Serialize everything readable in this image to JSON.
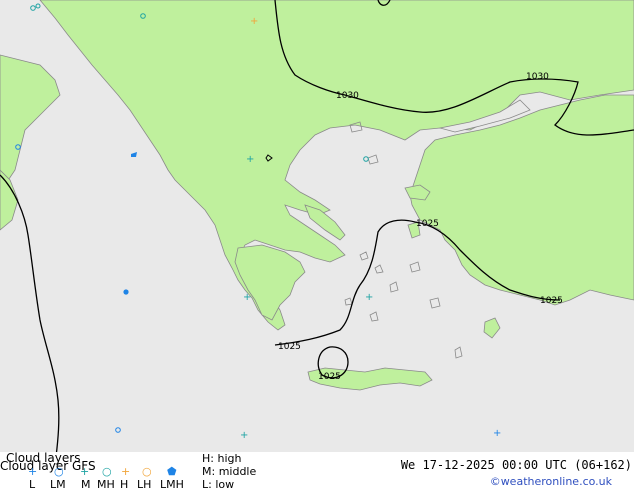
{
  "colors": {
    "sea": "#e9e9e9",
    "land": "#bff09d",
    "isobar": "#000000",
    "coast": "#8a8a8a",
    "high_symbol": "#f1a53a",
    "middle_symbol": "#1ea3a3",
    "low_symbol": "#1f84e6",
    "credit": "#2f4fbf"
  },
  "isobars": {
    "labels": [
      "1030",
      "1030",
      "1025",
      "1025",
      "1025",
      "1025"
    ]
  },
  "legend": {
    "title": "Cloud layers",
    "model_label": "Cloud layer  GFS",
    "symbols": [
      {
        "label": "L",
        "icon": "plus-blue"
      },
      {
        "label": "LM",
        "icon": "circle-blue"
      },
      {
        "label": "M",
        "icon": "plus-teal"
      },
      {
        "label": "MH",
        "icon": "circle-teal"
      },
      {
        "label": "H",
        "icon": "plus-orange"
      },
      {
        "label": "LH",
        "icon": "circle-orange"
      },
      {
        "label": "LMH",
        "icon": "filled-blue"
      }
    ],
    "key": {
      "high": "H: high",
      "middle": "M: middle",
      "low": "L: low"
    },
    "datetime": "We 17-12-2025 00:00 UTC (06+162)",
    "credit": "©weatheronline.co.uk"
  }
}
